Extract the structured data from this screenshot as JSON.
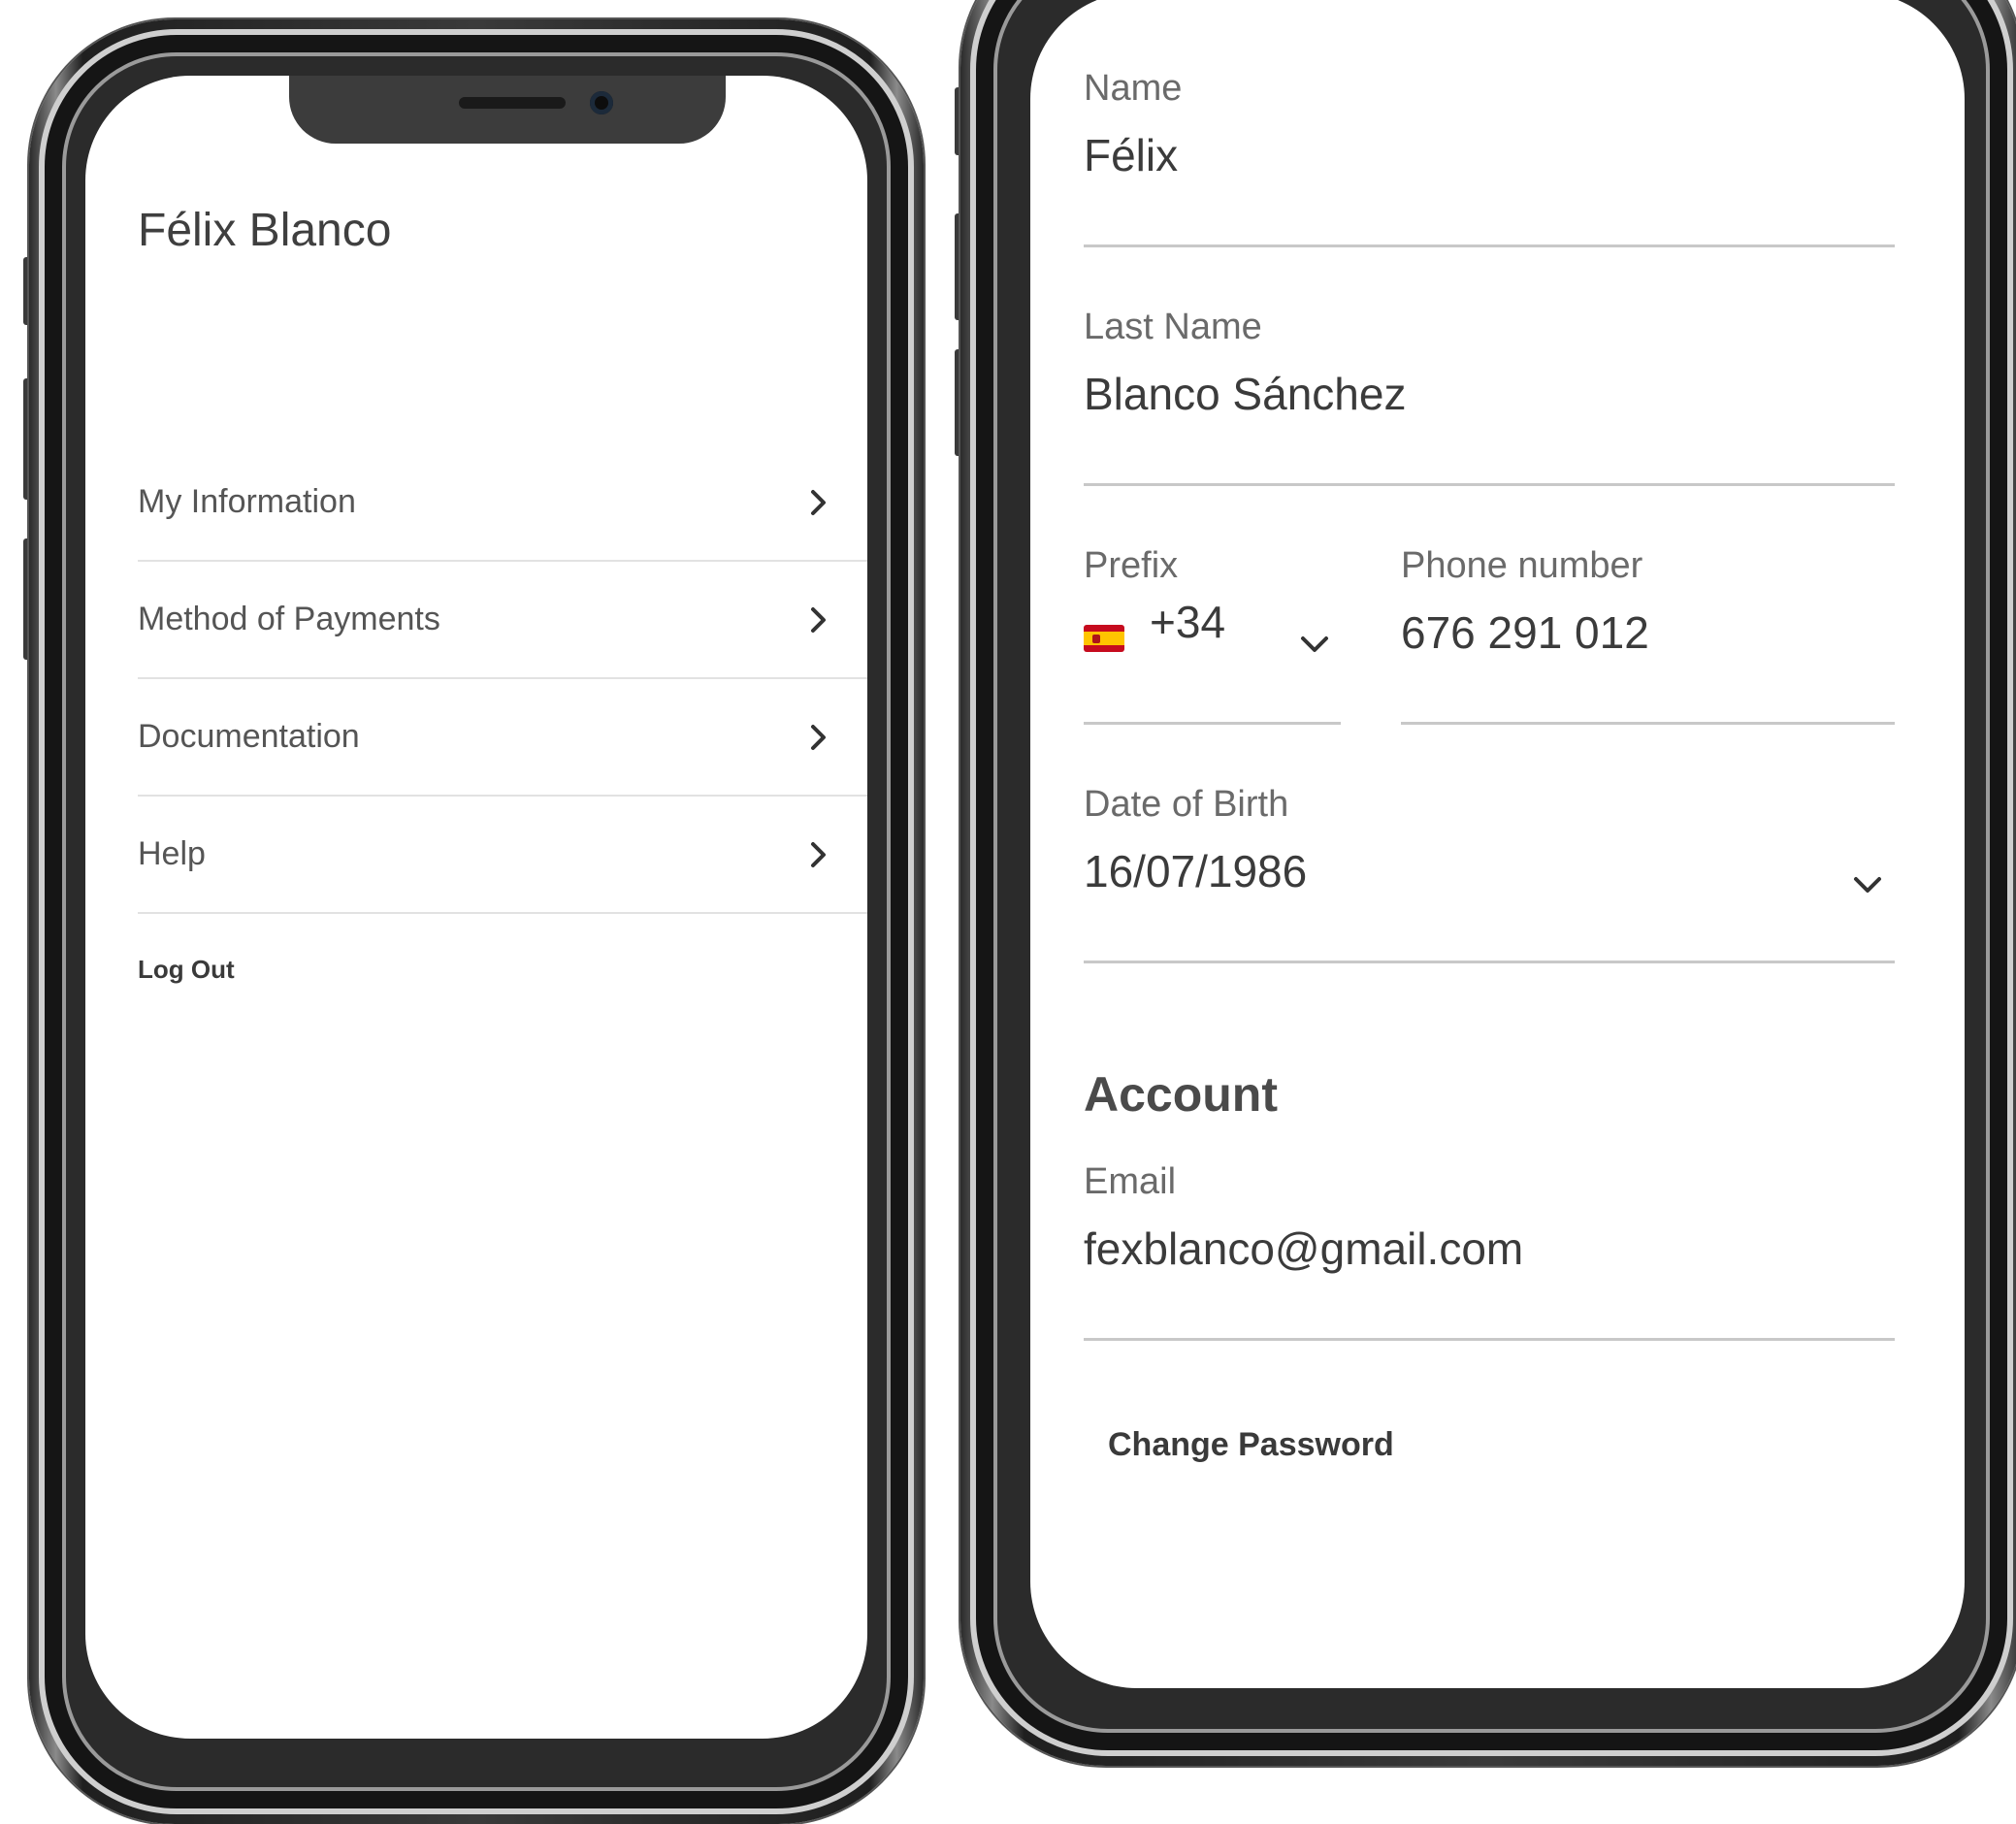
{
  "left_screen": {
    "profile_name": "Félix Blanco",
    "menu": [
      {
        "label": "My Information"
      },
      {
        "label": "Method of Payments"
      },
      {
        "label": "Documentation"
      },
      {
        "label": "Help"
      }
    ],
    "logout_label": "Log Out"
  },
  "right_screen": {
    "name": {
      "label": "Name",
      "value": "Félix"
    },
    "last_name": {
      "label": "Last Name",
      "value": "Blanco Sánchez"
    },
    "prefix": {
      "label": "Prefix",
      "value": "+34",
      "flag": "spain-flag-icon"
    },
    "phone": {
      "label": "Phone number",
      "value": "676 291 012"
    },
    "dob": {
      "label": "Date of Birth",
      "value": "16/07/1986"
    },
    "account_title": "Account",
    "email": {
      "label": "Email",
      "value": "fexblanco@gmail.com"
    },
    "change_password_label": "Change Password"
  },
  "colors": {
    "text_dark": "#3b3b3b",
    "text_label": "#6a6a6a",
    "divider": "#e2e2e2",
    "bezel": "#1f1f1f"
  }
}
